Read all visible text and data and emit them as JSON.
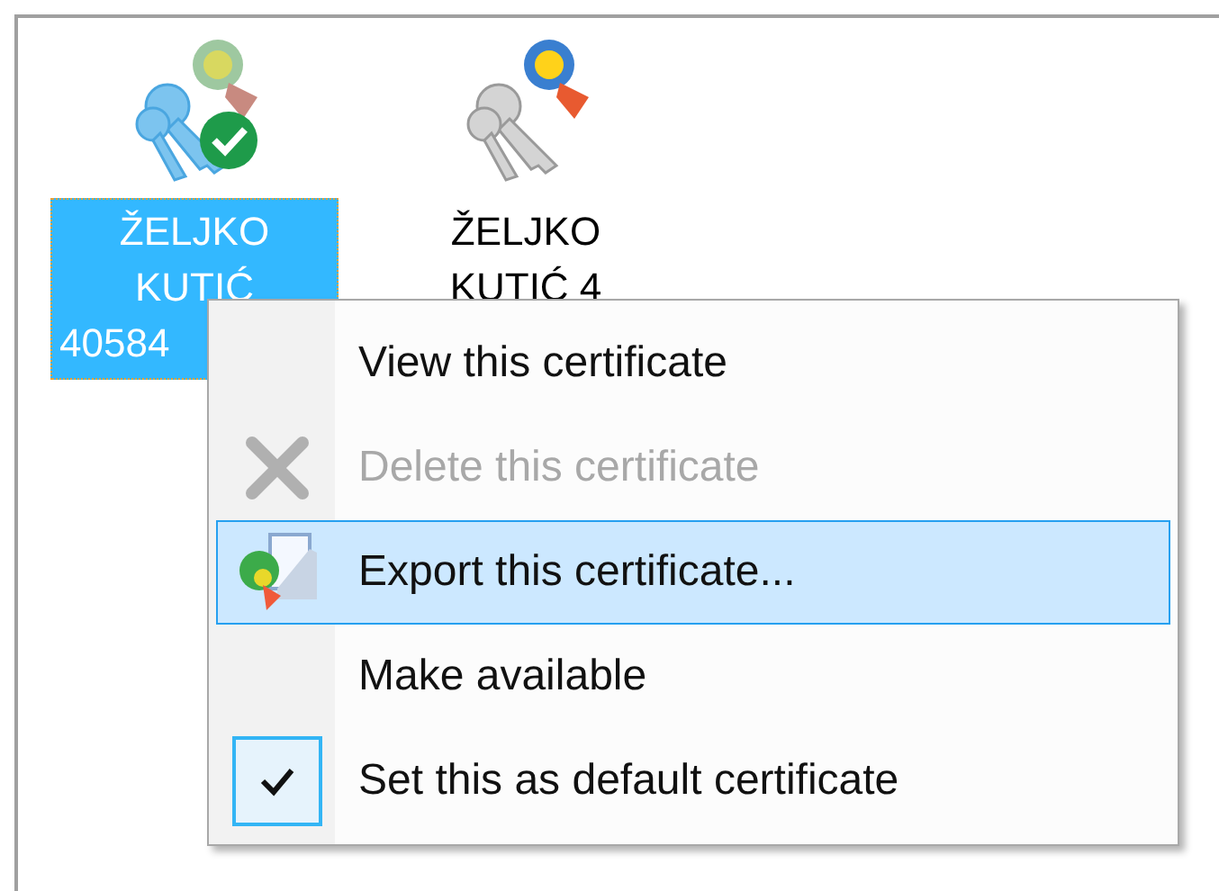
{
  "certificates": [
    {
      "lines": [
        "ŽELJKO",
        "KUTIĆ",
        "40584"
      ],
      "selected": true,
      "default": true
    },
    {
      "lines": [
        "ŽELJKO",
        "KUTIĆ 4"
      ],
      "selected": false,
      "default": false
    }
  ],
  "context_menu": {
    "items": [
      {
        "label": "View this certificate",
        "kind": "text",
        "disabled": false,
        "selected": false,
        "checked": false
      },
      {
        "label": "Delete this certificate",
        "kind": "delete",
        "disabled": true,
        "selected": false,
        "checked": false
      },
      {
        "label": "Export this certificate...",
        "kind": "export",
        "disabled": false,
        "selected": true,
        "checked": false
      },
      {
        "label": "Make available",
        "kind": "text",
        "disabled": false,
        "selected": false,
        "checked": false
      },
      {
        "label": "Set this as default certificate",
        "kind": "text",
        "disabled": false,
        "selected": false,
        "checked": true
      }
    ]
  }
}
